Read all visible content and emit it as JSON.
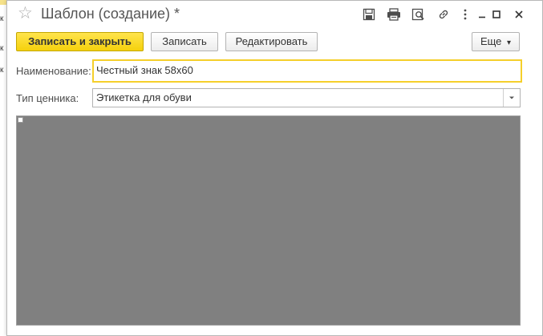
{
  "window": {
    "title": "Шаблон (создание) *",
    "favorite_icon": "star-icon",
    "title_icons": [
      "save-icon",
      "print-icon",
      "preview-icon",
      "link-icon",
      "more-vertical-icon",
      "minimize-icon",
      "maximize-icon",
      "close-icon"
    ]
  },
  "background": {
    "letters": [
      "к",
      "к",
      "к"
    ]
  },
  "toolbar": {
    "save_close_label": "Записать и закрыть",
    "save_label": "Записать",
    "edit_label": "Редактировать",
    "more_label": "Еще",
    "more_arrow": "▾"
  },
  "form": {
    "name_label": "Наименование:",
    "name_value": "Честный знак 58x60",
    "type_label": "Тип ценника:",
    "type_value": "Этикетка для обуви"
  },
  "colors": {
    "primary_button": "#f5d10c",
    "focus_border": "#f5cf2b",
    "preview_background": "#808080"
  }
}
